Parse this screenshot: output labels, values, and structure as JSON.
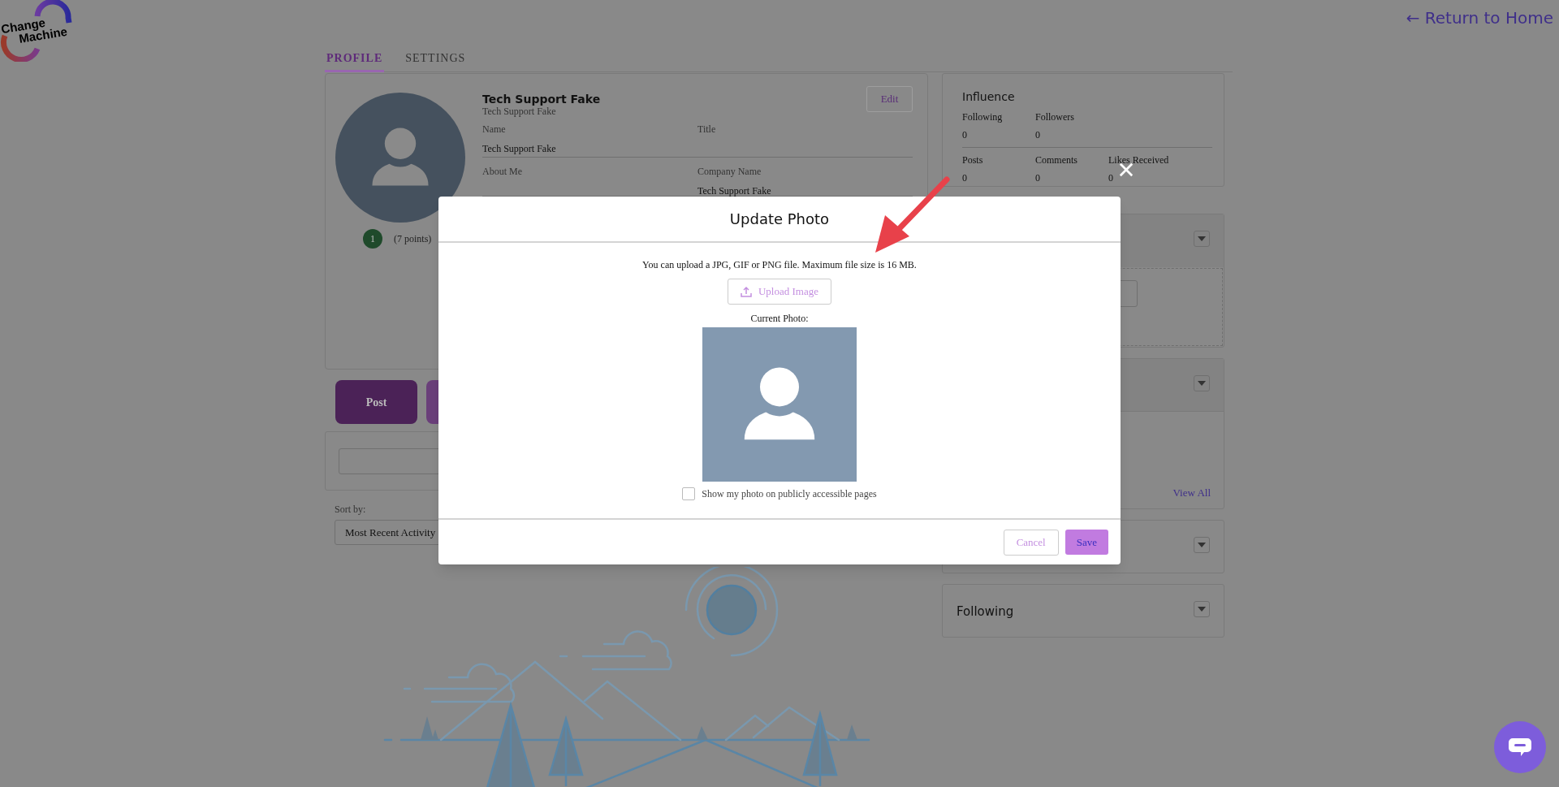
{
  "logo": {
    "line_1": "Change",
    "line_2": "Machine"
  },
  "return_link": "← Return to Home",
  "tabs": [
    {
      "label": "PROFILE",
      "selected": true
    },
    {
      "label": "SETTINGS",
      "selected": false
    }
  ],
  "profile": {
    "display_name": "Tech Support Fake",
    "subtitle": "Tech Support Fake",
    "edit_button": "Edit",
    "level_badge": "1",
    "points": "(7 points)",
    "fields": [
      {
        "label": "Name",
        "value": "Tech Support Fake"
      },
      {
        "label": "Title"
      },
      {
        "label": "About Me"
      },
      {
        "label": "Company Name",
        "value": "Tech Support Fake"
      }
    ]
  },
  "post_button": "Post",
  "sort": {
    "label": "Sort by:",
    "value": "Most Recent Activity"
  },
  "influence": {
    "title": "Influence",
    "rows": [
      [
        {
          "label": "Following",
          "value": "0"
        },
        {
          "label": "Followers",
          "value": "0"
        }
      ],
      [
        {
          "label": "Posts",
          "value": "0"
        },
        {
          "label": "Comments",
          "value": "0"
        },
        {
          "label": "Likes Received",
          "value": "0"
        }
      ]
    ]
  },
  "panels": [
    {
      "kind": "upload"
    },
    {
      "kind": "list",
      "link": "View All"
    },
    {
      "kind": "plain"
    },
    {
      "kind": "titled",
      "title": "Following"
    }
  ],
  "modal": {
    "title": "Update Photo",
    "hint": "You can upload a JPG, GIF or PNG file. Maximum file size is 16 MB.",
    "upload_button": "Upload Image",
    "current_photo_label": "Current Photo:",
    "public_photo": {
      "label": "Show my photo on publicly accessible pages",
      "checked": false
    },
    "buttons": [
      {
        "label": "Cancel",
        "kind": "secondary"
      },
      {
        "label": "Save",
        "kind": "primary"
      }
    ]
  }
}
